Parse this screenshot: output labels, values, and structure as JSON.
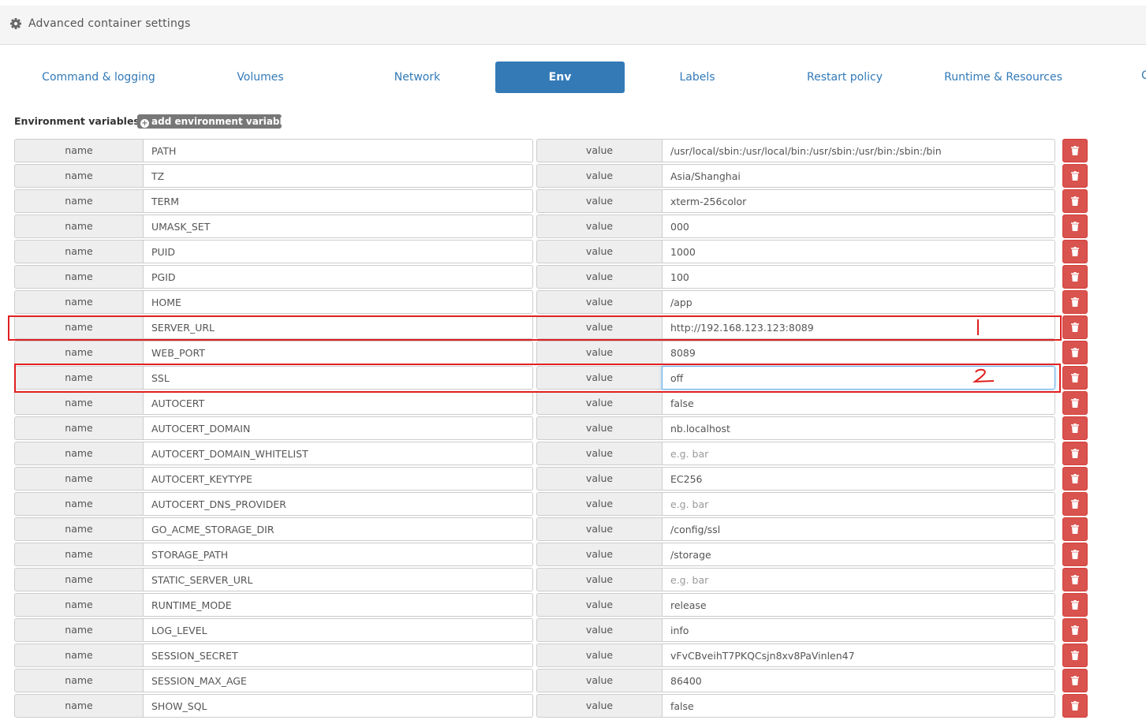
{
  "panel": {
    "title": "Advanced container settings",
    "icon": "gear-icon"
  },
  "tabs": [
    {
      "label": "Command & logging",
      "active": false
    },
    {
      "label": "Volumes",
      "active": false
    },
    {
      "label": "Network",
      "active": false
    },
    {
      "label": "Env",
      "active": true
    },
    {
      "label": "Labels",
      "active": false
    },
    {
      "label": "Restart policy",
      "active": false
    },
    {
      "label": "Runtime & Resources",
      "active": false
    }
  ],
  "env": {
    "section_label": "Environment variables",
    "add_button_label": "add environment variable",
    "name_addon": "name",
    "value_addon": "value",
    "value_placeholder": "e.g. bar",
    "variables": [
      {
        "name": "PATH",
        "value": "/usr/local/sbin:/usr/local/bin:/usr/sbin:/usr/bin:/sbin:/bin"
      },
      {
        "name": "TZ",
        "value": "Asia/Shanghai"
      },
      {
        "name": "TERM",
        "value": "xterm-256color"
      },
      {
        "name": "UMASK_SET",
        "value": "000"
      },
      {
        "name": "PUID",
        "value": "1000"
      },
      {
        "name": "PGID",
        "value": "100"
      },
      {
        "name": "HOME",
        "value": "/app"
      },
      {
        "name": "SERVER_URL",
        "value": "http://192.168.123.123:8089"
      },
      {
        "name": "WEB_PORT",
        "value": "8089"
      },
      {
        "name": "SSL",
        "value": "off",
        "focused": true
      },
      {
        "name": "AUTOCERT",
        "value": "false"
      },
      {
        "name": "AUTOCERT_DOMAIN",
        "value": "nb.localhost"
      },
      {
        "name": "AUTOCERT_DOMAIN_WHITELIST",
        "value": ""
      },
      {
        "name": "AUTOCERT_KEYTYPE",
        "value": "EC256"
      },
      {
        "name": "AUTOCERT_DNS_PROVIDER",
        "value": ""
      },
      {
        "name": "GO_ACME_STORAGE_DIR",
        "value": "/config/ssl"
      },
      {
        "name": "STORAGE_PATH",
        "value": "/storage"
      },
      {
        "name": "STATIC_SERVER_URL",
        "value": ""
      },
      {
        "name": "RUNTIME_MODE",
        "value": "release"
      },
      {
        "name": "LOG_LEVEL",
        "value": "info"
      },
      {
        "name": "SESSION_SECRET",
        "value": "vFvCBveihT7PKQCsjn8xv8PaVinlen47"
      },
      {
        "name": "SESSION_MAX_AGE",
        "value": "86400"
      },
      {
        "name": "SHOW_SQL",
        "value": "false"
      }
    ]
  },
  "colors": {
    "primary": "#337ab7",
    "danger": "#d9534f",
    "annotation": "#e02020"
  }
}
